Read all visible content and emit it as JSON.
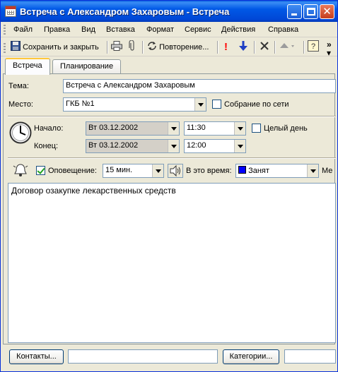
{
  "window": {
    "title": "Встреча с Александром Захаровым - Встреча"
  },
  "menu": [
    "Файл",
    "Правка",
    "Вид",
    "Вставка",
    "Формат",
    "Сервис",
    "Действия",
    "Справка"
  ],
  "toolbar": {
    "save_close": "Сохранить и закрыть",
    "recurrence": "Повторение...",
    "icons": [
      "save-icon",
      "print-icon",
      "attach-icon",
      "recurrence-icon",
      "importance-high-icon",
      "importance-low-icon",
      "delete-icon",
      "previous-item-icon",
      "help-icon",
      "overflow-icon"
    ]
  },
  "tabs": [
    "Встреча",
    "Планирование"
  ],
  "form": {
    "subject_label": "Тема:",
    "subject_value": "Встреча с Александром Захаровым",
    "location_label": "Место:",
    "location_value": "ГКБ №1",
    "online_meeting_label": "Собрание по сети",
    "start_label": "Начало:",
    "start_date": "Вт 03.12.2002",
    "start_time": "11:30",
    "all_day_label": "Целый день",
    "end_label": "Конец:",
    "end_date": "Вт 03.12.2002",
    "end_time": "12:00",
    "reminder_label": "Оповещение:",
    "reminder_value": "15 мин.",
    "show_as_label": "В это время:",
    "show_as_value": "Занят",
    "show_as_color": "#0000ff",
    "label_truncated": "Ме",
    "notes": "Договор озакупке лекарственных средств"
  },
  "bottom": {
    "contacts_button": "Контакты...",
    "categories_button": "Категории..."
  },
  "colors": {
    "titlebar": "#0054e3",
    "importance_high": "#ff0000",
    "importance_low": "#1f3fc4"
  }
}
